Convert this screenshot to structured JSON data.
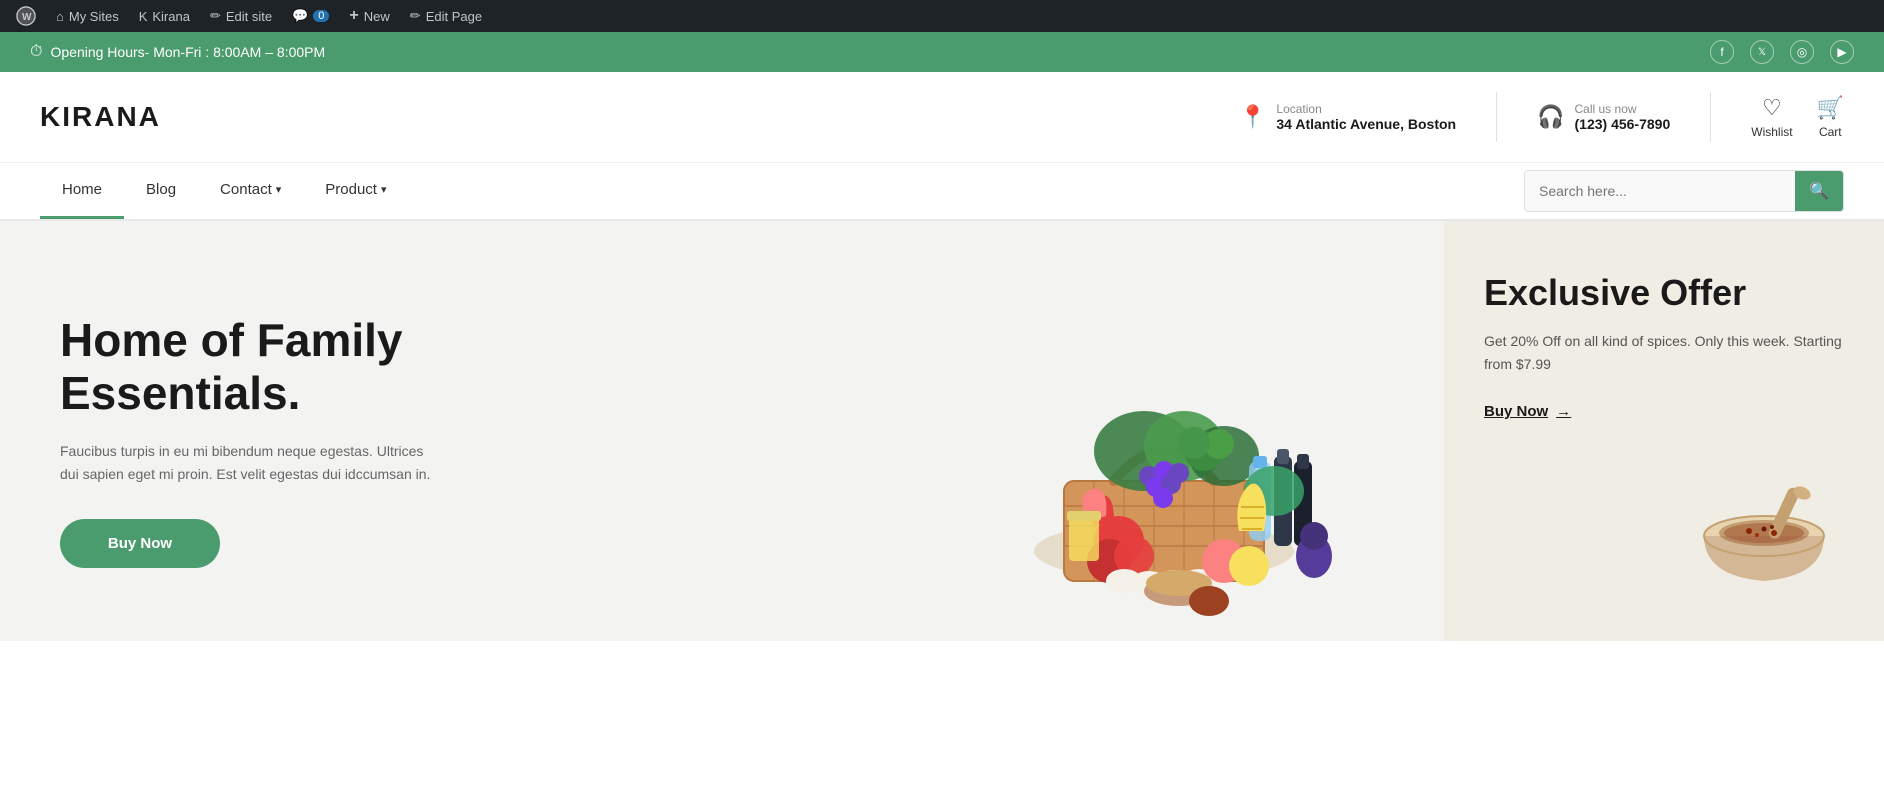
{
  "admin_bar": {
    "wp_logo": "WordPress",
    "my_sites_label": "My Sites",
    "kirana_label": "Kirana",
    "edit_site_label": "Edit site",
    "comments_label": "0",
    "new_label": "New",
    "edit_page_label": "Edit Page"
  },
  "announcement": {
    "text": "Opening Hours- Mon-Fri : 8:00AM – 8:00PM",
    "socials": [
      "f",
      "𝕏",
      "◎",
      "▶"
    ]
  },
  "header": {
    "logo": "KIRANA",
    "location_label": "Location",
    "location_value": "34 Atlantic Avenue, Boston",
    "call_label": "Call us now",
    "call_value": "(123) 456-7890",
    "wishlist_label": "Wishlist",
    "cart_label": "Cart"
  },
  "nav": {
    "items": [
      {
        "label": "Home",
        "active": true,
        "has_dropdown": false
      },
      {
        "label": "Blog",
        "active": false,
        "has_dropdown": false
      },
      {
        "label": "Contact",
        "active": false,
        "has_dropdown": true
      },
      {
        "label": "Product",
        "active": false,
        "has_dropdown": true
      }
    ],
    "search_placeholder": "Search here..."
  },
  "hero": {
    "title": "Home of Family Essentials.",
    "description": "Faucibus turpis in eu mi bibendum neque egestas. Ultrices dui sapien eget mi proin. Est velit egestas dui idccumsan in.",
    "cta_label": "Buy Now"
  },
  "offer": {
    "title": "Exclusive Offer",
    "description": "Get 20% Off on all kind of spices. Only this week. Starting from $7.99",
    "cta_label": "Buy Now",
    "cta_arrow": "→"
  }
}
